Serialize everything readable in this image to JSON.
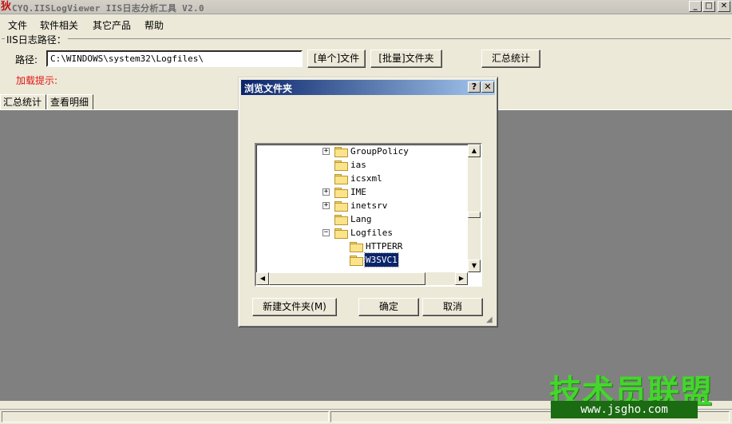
{
  "window": {
    "title": "CYQ.IISLogViewer IIS日志分析工具 V2.0",
    "icon_char": "狄"
  },
  "caption_buttons": {
    "minimize": "_",
    "maximize": "□",
    "close": "✕"
  },
  "menu": [
    "文件",
    "软件相关",
    "其它产品",
    "帮助"
  ],
  "group": {
    "legend": "IIS日志路径：",
    "path_label": "路径:",
    "path_value": "C:\\WINDOWS\\system32\\Logfiles\\",
    "single_file_button": "[单个]文件",
    "batch_folder_button": "[批量]文件夹",
    "summary_button": "汇总统计",
    "hint_label": "加载提示:"
  },
  "tabs": [
    "汇总统计",
    "查看明细"
  ],
  "dialog": {
    "title": "浏览文件夹",
    "help_button": "?",
    "close_button": "✕",
    "tree": [
      {
        "label": "GroupPolicy",
        "expander": "+",
        "level": 0
      },
      {
        "label": "ias",
        "expander": "",
        "level": 0
      },
      {
        "label": "icsxml",
        "expander": "",
        "level": 0
      },
      {
        "label": "IME",
        "expander": "+",
        "level": 0
      },
      {
        "label": "inetsrv",
        "expander": "+",
        "level": 0
      },
      {
        "label": "Lang",
        "expander": "",
        "level": 0
      },
      {
        "label": "Logfiles",
        "expander": "−",
        "level": 0
      },
      {
        "label": "HTTPERR",
        "expander": "",
        "level": 1
      },
      {
        "label": "W3SVC1",
        "expander": "",
        "level": 1,
        "selected": true
      }
    ],
    "new_folder_button": "新建文件夹(M)",
    "ok_button": "确定",
    "cancel_button": "取消"
  },
  "watermark": {
    "text": "技术员联盟",
    "url": "www.jsgho.com"
  },
  "colors": {
    "hint": "#e01515",
    "dialog_title_start": "#0a246a",
    "selection": "#0a246a",
    "watermark": "#44d62c"
  }
}
